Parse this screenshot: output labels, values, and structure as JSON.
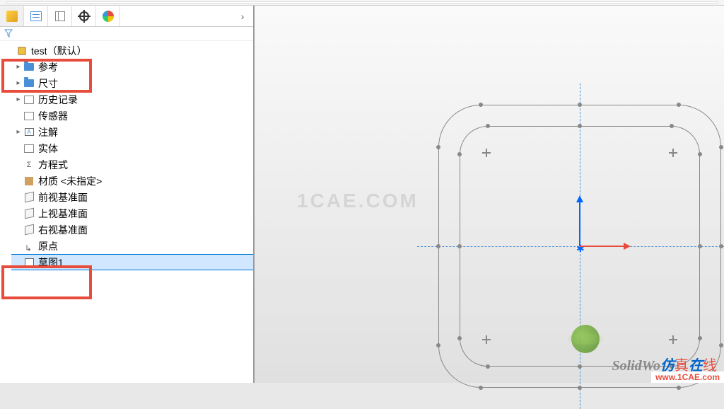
{
  "tabs": {
    "feature_tree": "FeatureManager",
    "property": "PropertyManager",
    "config": "ConfigurationManager",
    "dimxpert": "DimXpert",
    "display": "DisplayManager"
  },
  "filter_icon": "filter",
  "tree": {
    "root": "test（默认）",
    "items": [
      {
        "label": "参考",
        "icon": "folder",
        "expand": true
      },
      {
        "label": "尺寸",
        "icon": "folder",
        "expand": true
      },
      {
        "label": "历史记录",
        "icon": "history",
        "expand": true
      },
      {
        "label": "传感器",
        "icon": "sensor",
        "expand": false
      },
      {
        "label": "注解",
        "icon": "annot",
        "expand": true
      },
      {
        "label": "实体",
        "icon": "solid",
        "expand": false
      },
      {
        "label": "方程式",
        "icon": "equation",
        "expand": false
      },
      {
        "label": "材质 <未指定>",
        "icon": "material",
        "expand": false
      },
      {
        "label": "前视基准面",
        "icon": "plane",
        "expand": false
      },
      {
        "label": "上视基准面",
        "icon": "plane",
        "expand": false
      },
      {
        "label": "右视基准面",
        "icon": "plane",
        "expand": false
      },
      {
        "label": "原点",
        "icon": "origin",
        "expand": false
      },
      {
        "label": "草图1",
        "icon": "sketch",
        "expand": false,
        "selected": true
      }
    ]
  },
  "watermark": {
    "center": "1CAE.COM",
    "bottom_sw": "SolidWo",
    "bottom_rest1": "仿",
    "bottom_hi": "真",
    "bottom_rest2": "在",
    "bottom_blue": "线",
    "url": "www.1CAE.com"
  }
}
